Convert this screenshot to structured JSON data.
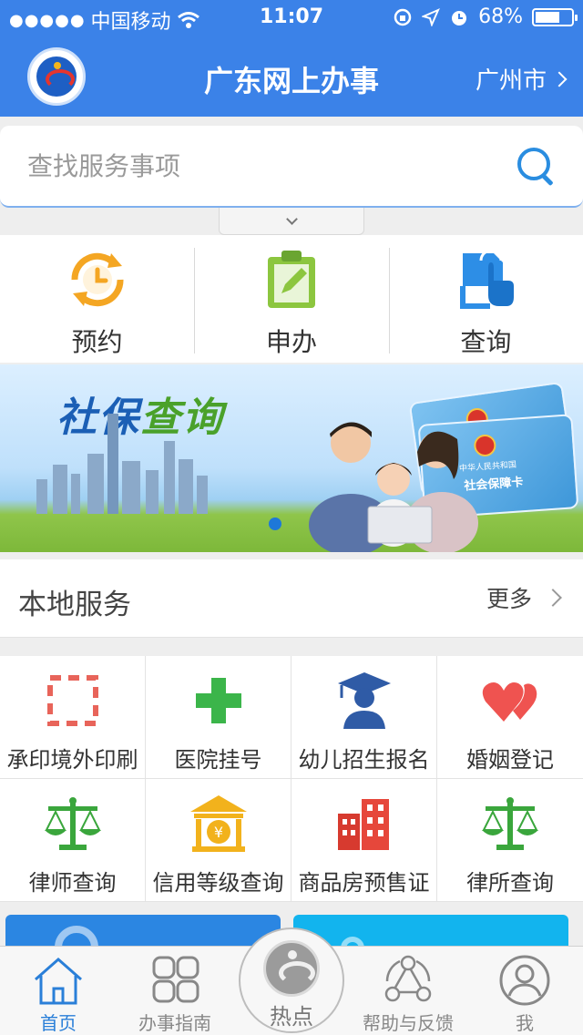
{
  "status_bar": {
    "carrier": "中国移动",
    "time": "11:07",
    "battery": "68%",
    "battery_level": 0.68
  },
  "nav": {
    "title": "广东网上办事",
    "city": "广州市"
  },
  "search": {
    "placeholder": "查找服务事项"
  },
  "quick_actions": [
    {
      "label": "预约",
      "icon": "clock-icon"
    },
    {
      "label": "申办",
      "icon": "clipboard-edit-icon"
    },
    {
      "label": "查询",
      "icon": "tap-document-icon"
    }
  ],
  "banner": {
    "title_part1": "社保",
    "title_part2": "查询",
    "card_title": "社会保障卡",
    "card_issuer": "中华人民共和国",
    "active_slide": 1
  },
  "local_services": {
    "title": "本地服务",
    "more_label": "更多",
    "items": [
      {
        "label": "承印境外印刷",
        "icon": "dashed-frame-icon"
      },
      {
        "label": "医院挂号",
        "icon": "medical-cross-icon"
      },
      {
        "label": "幼儿招生报名",
        "icon": "graduate-icon"
      },
      {
        "label": "婚姻登记",
        "icon": "hearts-icon"
      },
      {
        "label": "律师查询",
        "icon": "scales-icon"
      },
      {
        "label": "信用等级查询",
        "icon": "bank-yen-icon"
      },
      {
        "label": "商品房预售证",
        "icon": "buildings-icon"
      },
      {
        "label": "律所查询",
        "icon": "scales-icon"
      }
    ]
  },
  "tabs": [
    {
      "label": "首页",
      "icon": "home-icon",
      "active": true
    },
    {
      "label": "办事指南",
      "icon": "grid-icon",
      "active": false
    },
    {
      "label": "热点",
      "icon": "hot-logo-icon",
      "active": false
    },
    {
      "label": "帮助与反馈",
      "icon": "share-nodes-icon",
      "active": false
    },
    {
      "label": "我",
      "icon": "user-icon",
      "active": false
    }
  ],
  "colors": {
    "brand_blue": "#3b82e8",
    "accent_green": "#4aa12a",
    "tab_active": "#2a7fd8"
  }
}
